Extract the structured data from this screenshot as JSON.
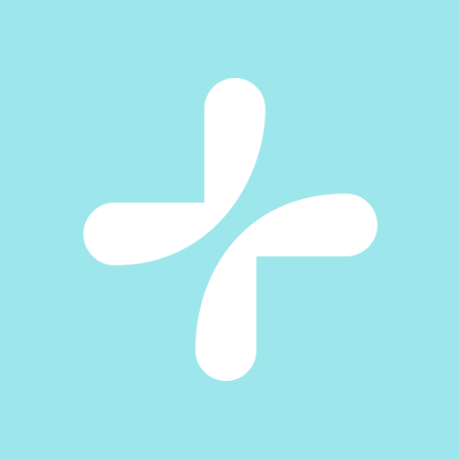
{
  "icon": {
    "name": "plus-pinwheel-logo",
    "background_color": "#9de6eb",
    "mark_color": "#ffffff"
  }
}
